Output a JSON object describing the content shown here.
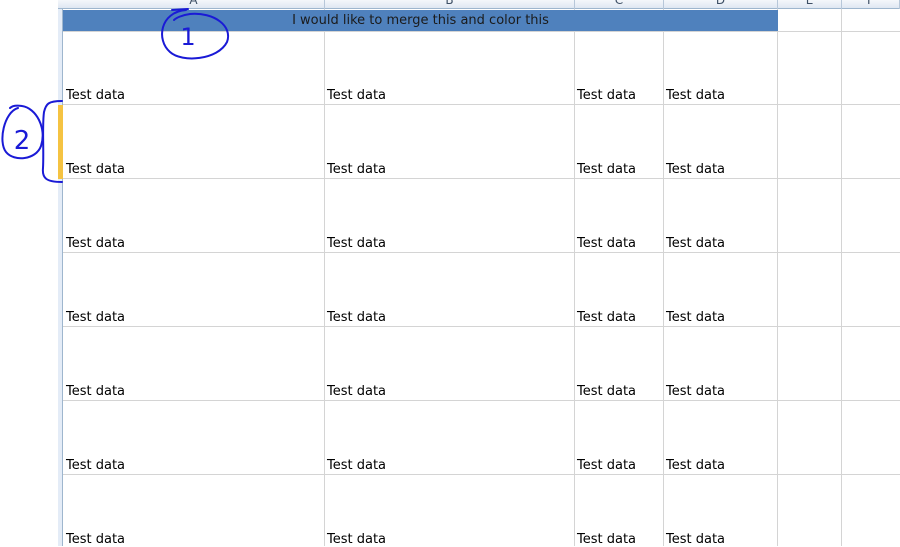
{
  "columns": [
    {
      "letter": "A"
    },
    {
      "letter": "B"
    },
    {
      "letter": "C"
    },
    {
      "letter": "D"
    },
    {
      "letter": "E"
    },
    {
      "letter": "F"
    }
  ],
  "merged_cell": {
    "text": "I would like to merge this and color this",
    "fill_color": "#4f81bd"
  },
  "rows": [
    [
      "Test data",
      "Test data",
      "Test data",
      "Test data"
    ],
    [
      "Test data",
      "Test data",
      "Test data",
      "Test data"
    ],
    [
      "Test data",
      "Test data",
      "Test data",
      "Test data"
    ],
    [
      "Test data",
      "Test data",
      "Test data",
      "Test data"
    ],
    [
      "Test data",
      "Test data",
      "Test data",
      "Test data"
    ],
    [
      "Test data",
      "Test data",
      "Test data",
      "Test data"
    ],
    [
      "Test data",
      "Test data",
      "Test data",
      "Test data"
    ]
  ],
  "annotations": {
    "marker_1": "1",
    "marker_2": "2",
    "ink_color": "#1a1ad6",
    "row_highlight_color": "#f5c342"
  }
}
